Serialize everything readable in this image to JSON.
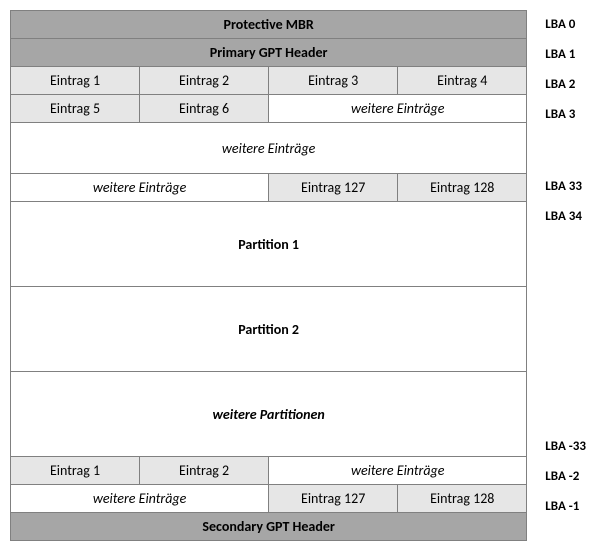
{
  "rows": {
    "mbr": "Protective MBR",
    "primary": "Primary GPT Header",
    "entry1": "Eintrag 1",
    "entry2": "Eintrag 2",
    "entry3": "Eintrag 3",
    "entry4": "Eintrag 4",
    "entry5": "Eintrag 5",
    "entry6": "Eintrag 6",
    "more_entries": "weitere Einträge",
    "entry127": "Eintrag 127",
    "entry128": "Eintrag 128",
    "partition1": "Partition 1",
    "partition2": "Partition 2",
    "more_partitions": "weitere Partitionen",
    "secondary": "Secondary GPT Header"
  },
  "lba": {
    "l0": "LBA 0",
    "l1": "LBA 1",
    "l2": "LBA 2",
    "l3": "LBA 3",
    "l33": "LBA 33",
    "l34": "LBA 34",
    "lm33": "LBA -33",
    "lm2": "LBA -2",
    "lm1": "LBA -1"
  }
}
